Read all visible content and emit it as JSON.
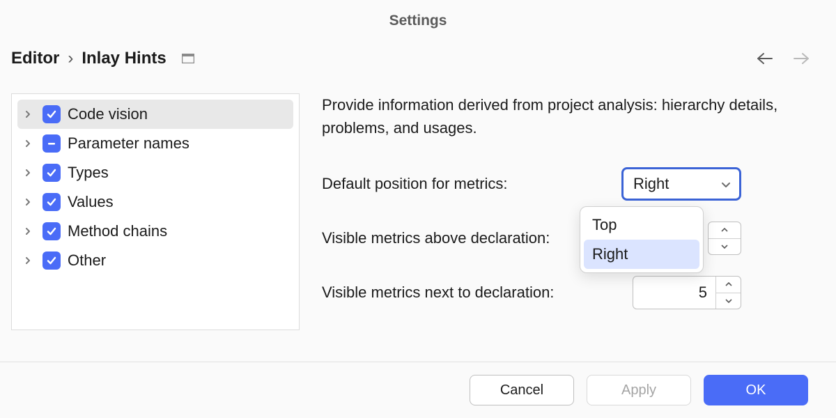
{
  "window": {
    "title": "Settings"
  },
  "breadcrumb": {
    "root": "Editor",
    "separator": "›",
    "leaf": "Inlay Hints"
  },
  "tree": {
    "items": [
      {
        "label": "Code vision",
        "checkbox": "checked",
        "selected": true
      },
      {
        "label": "Parameter names",
        "checkbox": "indeterminate",
        "selected": false
      },
      {
        "label": "Types",
        "checkbox": "checked",
        "selected": false
      },
      {
        "label": "Values",
        "checkbox": "checked",
        "selected": false
      },
      {
        "label": "Method chains",
        "checkbox": "checked",
        "selected": false
      },
      {
        "label": "Other",
        "checkbox": "checked",
        "selected": false
      }
    ]
  },
  "content": {
    "description": "Provide information derived from project analysis: hierarchy details, problems, and usages.",
    "default_position_label": "Default position for metrics:",
    "default_position_value": "Right",
    "default_position_options": [
      "Top",
      "Right"
    ],
    "visible_above_label": "Visible metrics above declaration:",
    "visible_above_value": "",
    "visible_next_label": "Visible metrics next to declaration:",
    "visible_next_value": "5"
  },
  "buttons": {
    "cancel": "Cancel",
    "apply": "Apply",
    "ok": "OK"
  }
}
